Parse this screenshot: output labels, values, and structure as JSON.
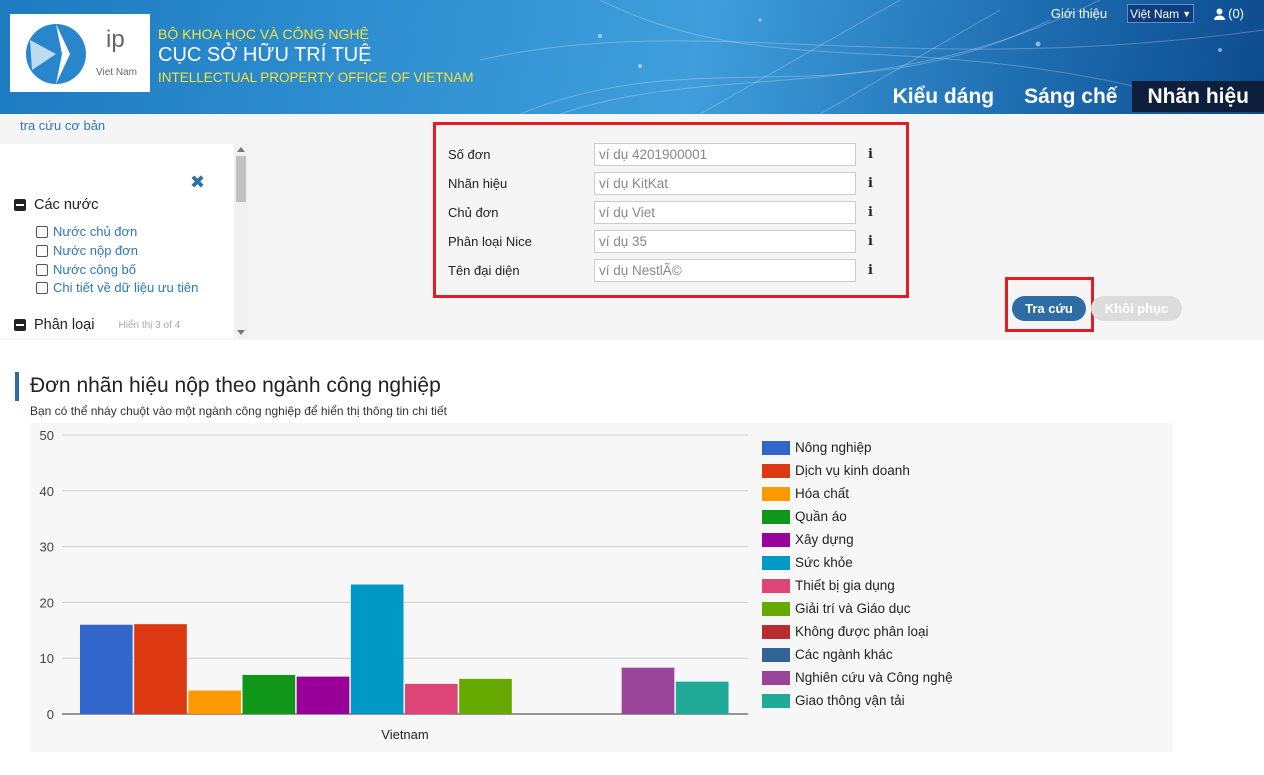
{
  "header": {
    "org_line1": "BỘ KHOA HỌC VÀ CÔNG NGHỆ",
    "org_line2": "CỤC SỞ HỮU TRÍ TUỆ",
    "org_line3": "INTELLECTUAL PROPERTY OFFICE OF VIETNAM",
    "logo_ip": "ip",
    "logo_vn": "Viet Nam",
    "top_links": {
      "intro": "Giới thiệu",
      "language": "Việt Nam",
      "cart": "(0)"
    },
    "nav": [
      {
        "label": "Kiểu dáng",
        "active": false
      },
      {
        "label": "Sáng chế",
        "active": false
      },
      {
        "label": "Nhãn hiệu",
        "active": true
      }
    ]
  },
  "breadcrumb": "tra cứu cơ bản",
  "sidebar": {
    "sections": [
      {
        "title": "Các nước",
        "items": [
          "Nước chủ đơn",
          "Nước nộp đơn",
          "Nước công bố",
          "Chi tiết về dữ liệu ưu tiên"
        ]
      },
      {
        "title": "Phân loại",
        "hint": "Hiển thị 3 of 4"
      }
    ]
  },
  "search_form": {
    "fields": [
      {
        "label": "Số đơn",
        "placeholder": "ví dụ 4201900001"
      },
      {
        "label": "Nhãn hiệu",
        "placeholder": "ví dụ KitKat"
      },
      {
        "label": "Chủ đơn",
        "placeholder": "ví dụ Viet"
      },
      {
        "label": "Phân loại Nice",
        "placeholder": "ví dụ 35"
      },
      {
        "label": "Tên đại diện",
        "placeholder": "ví dụ NestlÃ©"
      }
    ],
    "search_button": "Tra cứu",
    "reset_button": "Khôi phục"
  },
  "chart_section": {
    "title": "Đơn nhãn hiệu nộp theo ngành công nghiệp",
    "subtitle": "Bạn có thể nháy chuột vào một ngành công nghiệp để hiển thị thông tin chi tiết"
  },
  "chart_data": {
    "type": "bar",
    "categories": [
      "Vietnam"
    ],
    "xlabel": "",
    "ylabel": "",
    "ylim": [
      0,
      50
    ],
    "yticks": [
      0,
      10,
      20,
      30,
      40,
      50
    ],
    "grid": true,
    "legend": "right",
    "series": [
      {
        "name": "Nông nghiệp",
        "color": "#3366cc",
        "values": [
          16
        ]
      },
      {
        "name": "Dịch vụ kinh doanh",
        "color": "#dc3912",
        "values": [
          16.1
        ]
      },
      {
        "name": "Hóa chất",
        "color": "#ff9900",
        "values": [
          4.2
        ]
      },
      {
        "name": "Quần áo",
        "color": "#109618",
        "values": [
          7
        ]
      },
      {
        "name": "Xây dựng",
        "color": "#990099",
        "values": [
          6.7
        ]
      },
      {
        "name": "Sức khỏe",
        "color": "#0099c6",
        "values": [
          23.2
        ]
      },
      {
        "name": "Thiết bị gia dụng",
        "color": "#dd4477",
        "values": [
          5.4
        ]
      },
      {
        "name": "Giải trí và Giáo dục",
        "color": "#66aa00",
        "values": [
          6.3
        ]
      },
      {
        "name": "Không được phân loại",
        "color": "#b82e2e",
        "values": [
          0
        ]
      },
      {
        "name": "Các ngành khác",
        "color": "#316395",
        "values": [
          0
        ]
      },
      {
        "name": "Nghiên cứu và Công nghệ",
        "color": "#994499",
        "values": [
          8.3
        ]
      },
      {
        "name": "Giao thông vận tải",
        "color": "#22aa99",
        "values": [
          5.8
        ]
      }
    ]
  }
}
